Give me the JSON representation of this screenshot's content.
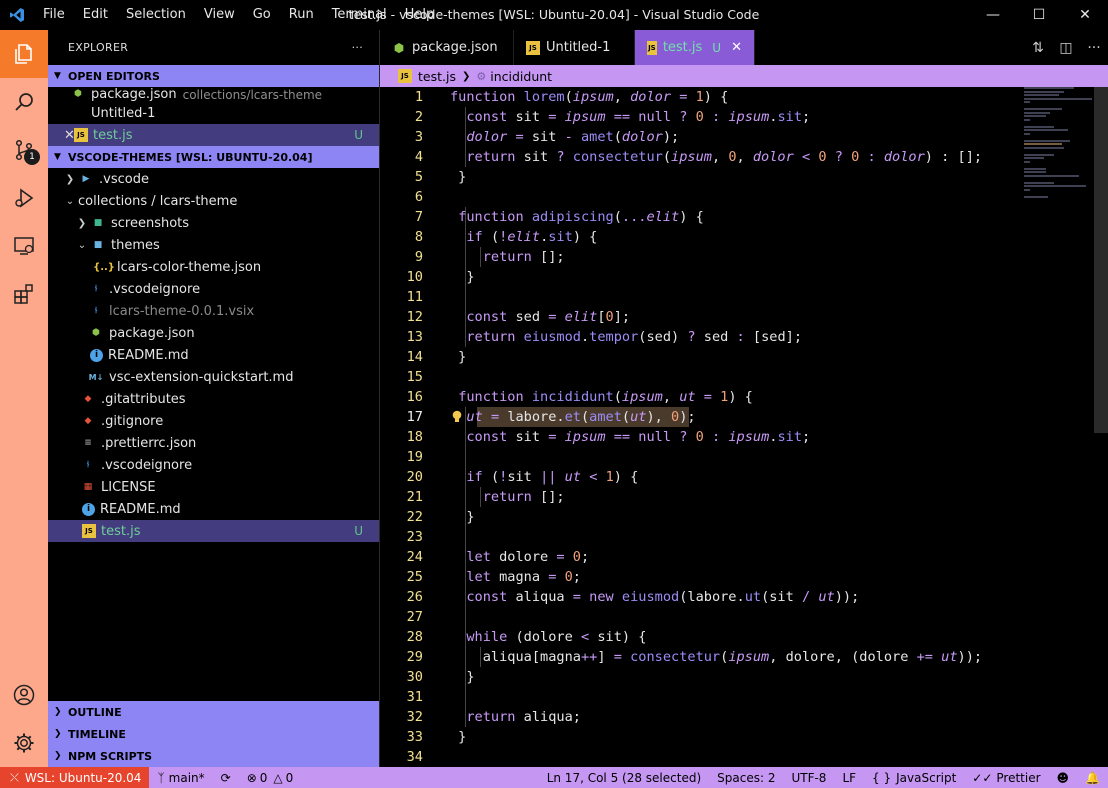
{
  "window": {
    "title": "test.js - vscode-themes [WSL: Ubuntu-20.04] - Visual Studio Code",
    "menu": [
      "File",
      "Edit",
      "Selection",
      "View",
      "Go",
      "Run",
      "Terminal",
      "Help"
    ]
  },
  "activity": {
    "scm_badge": "1"
  },
  "sidebar": {
    "title": "EXPLORER",
    "more": "···",
    "open_editors": {
      "label": "OPEN EDITORS",
      "items": [
        {
          "name": "package.json",
          "desc": "collections/lcars-theme"
        },
        {
          "name": "Untitled-1",
          "desc": ""
        },
        {
          "name": "test.js",
          "desc": "",
          "status": "U"
        }
      ]
    },
    "workspace": {
      "label": "VSCODE-THEMES [WSL: UBUNTU-20.04]",
      "items": [
        {
          "name": ".vscode"
        },
        {
          "name": "collections / lcars-theme"
        },
        {
          "name": "screenshots"
        },
        {
          "name": "themes"
        },
        {
          "name": "lcars-color-theme.json"
        },
        {
          "name": ".vscodeignore"
        },
        {
          "name": "lcars-theme-0.0.1.vsix"
        },
        {
          "name": "package.json"
        },
        {
          "name": "README.md"
        },
        {
          "name": "vsc-extension-quickstart.md"
        },
        {
          "name": ".gitattributes"
        },
        {
          "name": ".gitignore"
        },
        {
          "name": ".prettierrc.json"
        },
        {
          "name": ".vscodeignore"
        },
        {
          "name": "LICENSE"
        },
        {
          "name": "README.md"
        },
        {
          "name": "test.js",
          "status": "U"
        }
      ]
    },
    "bottom_sections": [
      "OUTLINE",
      "TIMELINE",
      "NPM SCRIPTS"
    ]
  },
  "tabs": [
    {
      "label": "package.json"
    },
    {
      "label": "Untitled-1"
    },
    {
      "label": "test.js",
      "status": "U",
      "close": "✕"
    }
  ],
  "breadcrumb": {
    "file": "test.js",
    "symbol": "incididunt"
  },
  "editor": {
    "line_numbers": [
      "1",
      "2",
      "3",
      "4",
      "5",
      "6",
      "7",
      "8",
      "9",
      "10",
      "11",
      "12",
      "13",
      "14",
      "15",
      "16",
      "17",
      "18",
      "19",
      "20",
      "21",
      "22",
      "23",
      "24",
      "25",
      "26",
      "27",
      "28",
      "29",
      "30",
      "31",
      "32",
      "33",
      "34"
    ],
    "current_line": "17"
  },
  "status": {
    "remote": "WSL: Ubuntu-20.04",
    "branch": "main*",
    "problems": "0",
    "warnings": "0",
    "cursor": "Ln 17, Col 5 (28 selected)",
    "spaces": "Spaces: 2",
    "encoding": "UTF-8",
    "eol": "LF",
    "language": "JavaScript",
    "formatter": "Prettier"
  },
  "colors": {
    "accent_orange": "#f57b2a",
    "activity_bg": "#fda88a",
    "section_purple": "#8e85f5",
    "statusbar": "#c597f2",
    "remote_red": "#e6442c"
  }
}
